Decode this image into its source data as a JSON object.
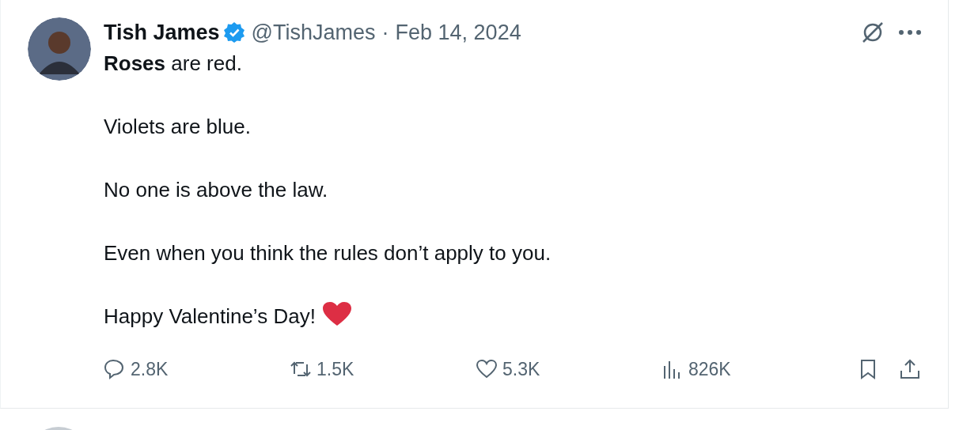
{
  "tweet": {
    "author_name": "Tish James",
    "verified": true,
    "handle": "@TishJames",
    "separator": "·",
    "date": "Feb 14, 2024",
    "paragraphs": [
      "**Roses** are red.",
      "Violets are blue.",
      "No one is above the law.",
      "Even when you think the rules don’t apply to you.",
      "Happy Valentine’s Day!"
    ],
    "ends_with_heart": true,
    "stats": [
      {
        "kind": "reply",
        "count": "2.8K"
      },
      {
        "kind": "repost",
        "count": "1.5K"
      },
      {
        "kind": "like",
        "count": "5.3K"
      },
      {
        "kind": "views",
        "count": "826K"
      }
    ]
  },
  "next_tweet": {
    "kind": "partial"
  }
}
